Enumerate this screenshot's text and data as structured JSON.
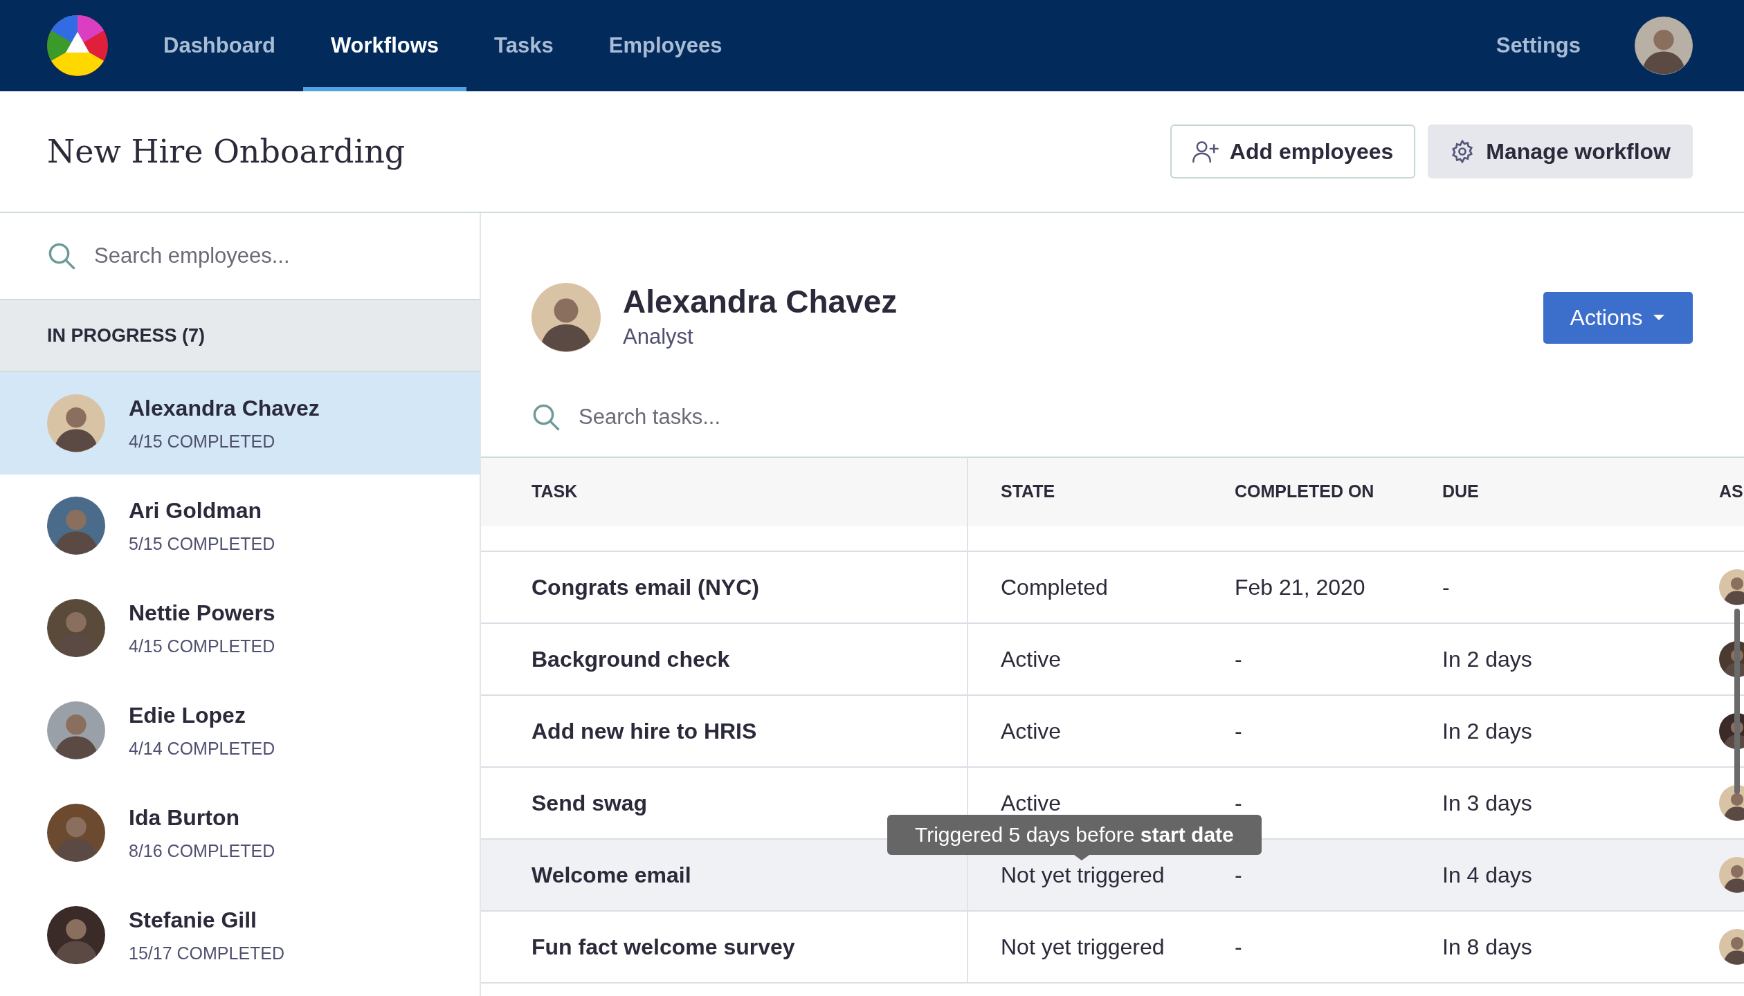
{
  "nav": {
    "items": [
      {
        "label": "Dashboard",
        "selected": false
      },
      {
        "label": "Workflows",
        "selected": true
      },
      {
        "label": "Tasks",
        "selected": false
      },
      {
        "label": "Employees",
        "selected": false
      }
    ],
    "settings": "Settings"
  },
  "header": {
    "title": "New Hire Onboarding",
    "buttons": [
      {
        "label": "Add employees",
        "kind": "outline"
      },
      {
        "label": "Manage workflow",
        "kind": "gray"
      }
    ]
  },
  "sidebar": {
    "search": {
      "placeholder": "Search employees..."
    },
    "group": "IN PROGRESS (7)",
    "employees": [
      {
        "name": "Alexandra Chavez",
        "progress": "4/15 COMPLETED",
        "selected": true
      },
      {
        "name": "Ari Goldman",
        "progress": "5/15 COMPLETED",
        "selected": false
      },
      {
        "name": "Nettie Powers",
        "progress": "4/15 COMPLETED",
        "selected": false
      },
      {
        "name": "Edie Lopez",
        "progress": "4/14 COMPLETED",
        "selected": false
      },
      {
        "name": "Ida Burton",
        "progress": "8/16 COMPLETED",
        "selected": false
      },
      {
        "name": "Stefanie Gill",
        "progress": "15/17 COMPLETED",
        "selected": false
      }
    ]
  },
  "profile": {
    "name": "Alexandra Chavez",
    "role": "Analyst",
    "actions": "Actions"
  },
  "task_search": {
    "placeholder": "Search tasks..."
  },
  "table": {
    "columns": [
      "TASK",
      "STATE",
      "COMPLETED ON",
      "DUE",
      "AS"
    ],
    "rows": [
      {
        "task": "Congrats email (NYC)",
        "state": "Completed",
        "completed_on": "Feb 21, 2020",
        "due": "-",
        "hovered": false
      },
      {
        "task": "Background check",
        "state": "Active",
        "completed_on": "-",
        "due": "In 2 days",
        "hovered": false
      },
      {
        "task": "Add new hire to HRIS",
        "state": "Active",
        "completed_on": "-",
        "due": "In 2 days",
        "hovered": false
      },
      {
        "task": "Send swag",
        "state": "Active",
        "completed_on": "-",
        "due": "In 3 days",
        "hovered": false
      },
      {
        "task": "Welcome email",
        "state": "Not yet triggered",
        "completed_on": "-",
        "due": "In 4 days",
        "hovered": true,
        "tooltip": "Triggered 5 days before **start date**"
      },
      {
        "task": "Fun fact welcome survey",
        "state": "Not yet triggered",
        "completed_on": "-",
        "due": "In 8 days",
        "hovered": false
      }
    ]
  }
}
